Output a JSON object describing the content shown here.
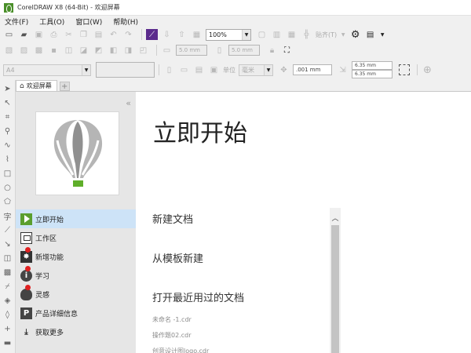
{
  "window": {
    "title": "CorelDRAW X8 (64-Bit) - 欢迎屏幕"
  },
  "menubar": {
    "items": [
      "文件(F)",
      "工具(O)",
      "窗口(W)",
      "帮助(H)"
    ]
  },
  "toolbar": {
    "zoom_value": "100%",
    "paste_label": "贴齐(T)"
  },
  "propertybar": {
    "width_value": "5.0 mm",
    "height_value": "5.0 mm"
  },
  "propertybar2": {
    "units_label": "单位",
    "units_value": "毫米",
    "nudge_value": ".001 mm",
    "dup_x_value": "6.35 mm",
    "dup_y_value": "6.35 mm"
  },
  "tabs": [
    {
      "label": "欢迎屏幕"
    }
  ],
  "sidebar": {
    "items": [
      {
        "label": "立即开始",
        "icon": "play-icon",
        "selected": true,
        "badge": false
      },
      {
        "label": "工作区",
        "icon": "workspace-icon",
        "selected": false,
        "badge": false
      },
      {
        "label": "新增功能",
        "icon": "whats-new-icon",
        "selected": false,
        "badge": true
      },
      {
        "label": "学习",
        "icon": "info-icon",
        "selected": false,
        "badge": true
      },
      {
        "label": "灵感",
        "icon": "lightbulb-icon",
        "selected": false,
        "badge": true
      },
      {
        "label": "产品详细信息",
        "icon": "product-icon",
        "selected": false,
        "badge": false
      },
      {
        "label": "获取更多",
        "icon": "download-icon",
        "selected": false,
        "badge": false
      }
    ]
  },
  "main": {
    "heading": "立即开始",
    "links": [
      {
        "label": "新建文档"
      },
      {
        "label": "从模板新建"
      },
      {
        "label": "打开最近用过的文档"
      }
    ],
    "recent_files": [
      "未命名 -1.cdr",
      "操作题02.cdr",
      "创意设计图logo.cdr"
    ]
  },
  "colors": {
    "accent_green": "#5a9e2e",
    "selection_blue": "#cde3f7",
    "badge_red": "#e02020"
  }
}
